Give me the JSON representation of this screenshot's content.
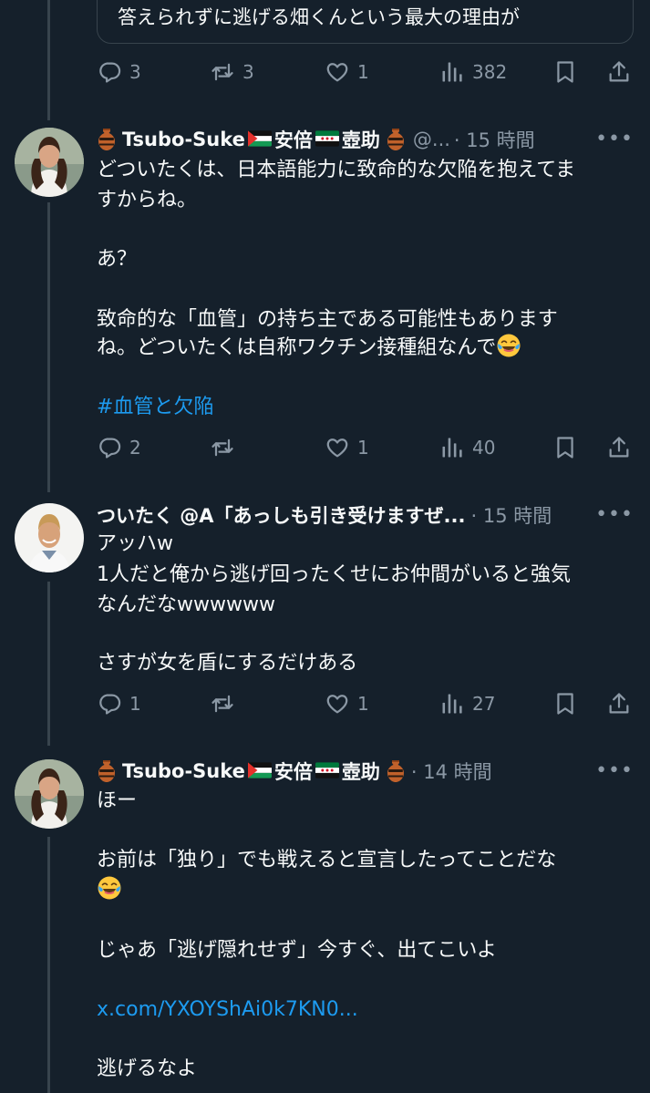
{
  "top_tweet": {
    "quote_text": "答えられずに逃げる畑くんという最大の理由が",
    "replies": "3",
    "retweets": "3",
    "likes": "1",
    "views": "382"
  },
  "tweets": [
    {
      "name_prefix": "Tsubo-Suke",
      "name_mid": "安倍",
      "name_suffix": "壺助",
      "handle": "@...",
      "time": "· 15 時間",
      "more": "•••",
      "lines": [
        "どついたくは、日本語能力に致命的な欠陥を抱えてま",
        "すからね。",
        "あ？",
        "致命的な「血管」の持ち主である可能性もあります",
        "ね。どついたくは自称ワクチン接種組なんで"
      ],
      "hashtag": "#血管と欠陥",
      "replies": "2",
      "retweets": "",
      "likes": "1",
      "views": "40"
    },
    {
      "name": "ついたく @A「あっしも引き受けますぜ...",
      "time": "· 15 時間",
      "more": "•••",
      "lines": [
        "アッハw",
        "1人だと俺から逃げ回ったくせにお仲間がいると強気",
        "なんだなwwwwww",
        "さすが女を盾にするだけある"
      ],
      "replies": "1",
      "retweets": "",
      "likes": "1",
      "views": "27"
    },
    {
      "name_prefix": "Tsubo-Suke",
      "name_mid": "安倍",
      "name_suffix": "壺助",
      "time": "· 14 時間",
      "more": "•••",
      "lines": [
        "ほー",
        "お前は「独り」でも戦えると宣言したってことだな",
        "じゃあ「逃げ隠れせず」今すぐ、出てこいよ",
        "逃げるなよ"
      ],
      "link": "x.com/YXOYShAi0k7KN0..."
    }
  ],
  "icons": {
    "reply": "reply-icon",
    "retweet": "retweet-icon",
    "like": "like-icon",
    "views": "views-icon",
    "bookmark": "bookmark-icon",
    "share": "share-icon"
  },
  "colors": {
    "background": "#15202b",
    "text": "#f7f9f9",
    "muted": "#8b98a5",
    "link": "#1d9bf0",
    "border": "#38444d"
  }
}
